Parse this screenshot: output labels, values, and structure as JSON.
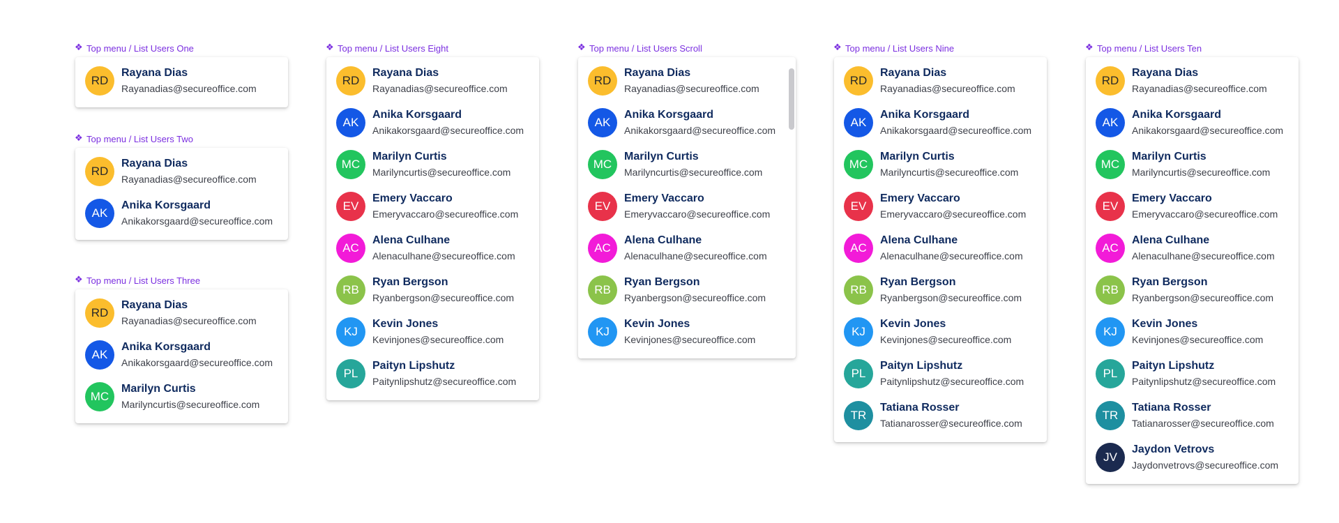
{
  "colors": {
    "label": "#7b2fe0",
    "name": "#0f2a5e",
    "email": "#3c3f48"
  },
  "users": [
    {
      "initials": "RD",
      "name": "Rayana Dias",
      "email": "Rayanadias@secureoffice.com",
      "color": "#fbbd2d",
      "text_color": "#2a2a2a"
    },
    {
      "initials": "AK",
      "name": "Anika Korsgaard",
      "email": "Anikakorsgaard@secureoffice.com",
      "color": "#1458e6",
      "text_color": "#ffffff"
    },
    {
      "initials": "MC",
      "name": "Marilyn Curtis",
      "email": "Marilyncurtis@secureoffice.com",
      "color": "#22c55e",
      "text_color": "#ffffff"
    },
    {
      "initials": "EV",
      "name": "Emery Vaccaro",
      "email": "Emeryvaccaro@secureoffice.com",
      "color": "#e8324a",
      "text_color": "#ffffff"
    },
    {
      "initials": "AC",
      "name": "Alena Culhane",
      "email": "Alenaculhane@secureoffice.com",
      "color": "#f21bd8",
      "text_color": "#ffffff"
    },
    {
      "initials": "RB",
      "name": "Ryan Bergson",
      "email": "Ryanbergson@secureoffice.com",
      "color": "#8bc34a",
      "text_color": "#ffffff"
    },
    {
      "initials": "KJ",
      "name": "Kevin Jones",
      "email": "Kevinjones@secureoffice.com",
      "color": "#2196f3",
      "text_color": "#ffffff"
    },
    {
      "initials": "PL",
      "name": "Paityn Lipshutz",
      "email": "Paitynlipshutz@secureoffice.com",
      "color": "#26a69a",
      "text_color": "#ffffff"
    },
    {
      "initials": "TR",
      "name": "Tatiana Rosser",
      "email": "Tatianarosser@secureoffice.com",
      "color": "#1e8fa0",
      "text_color": "#ffffff"
    },
    {
      "initials": "JV",
      "name": "Jaydon Vetrovs",
      "email": "Jaydonvetrovs@secureoffice.com",
      "color": "#1b2a4f",
      "text_color": "#ffffff"
    }
  ],
  "components": [
    {
      "id": "one",
      "label": "Top menu / List Users One",
      "count": 1,
      "scroll": false
    },
    {
      "id": "two",
      "label": "Top menu / List Users Two",
      "count": 2,
      "scroll": false
    },
    {
      "id": "three",
      "label": "Top menu / List Users Three",
      "count": 3,
      "scroll": false
    },
    {
      "id": "eight",
      "label": "Top menu / List Users Eight",
      "count": 8,
      "scroll": false
    },
    {
      "id": "scroll",
      "label": "Top menu / List Users Scroll",
      "count": 7,
      "scroll": true
    },
    {
      "id": "nine",
      "label": "Top menu / List Users Nine",
      "count": 9,
      "scroll": false
    },
    {
      "id": "ten",
      "label": "Top menu / List Users Ten",
      "count": 10,
      "scroll": false
    }
  ]
}
